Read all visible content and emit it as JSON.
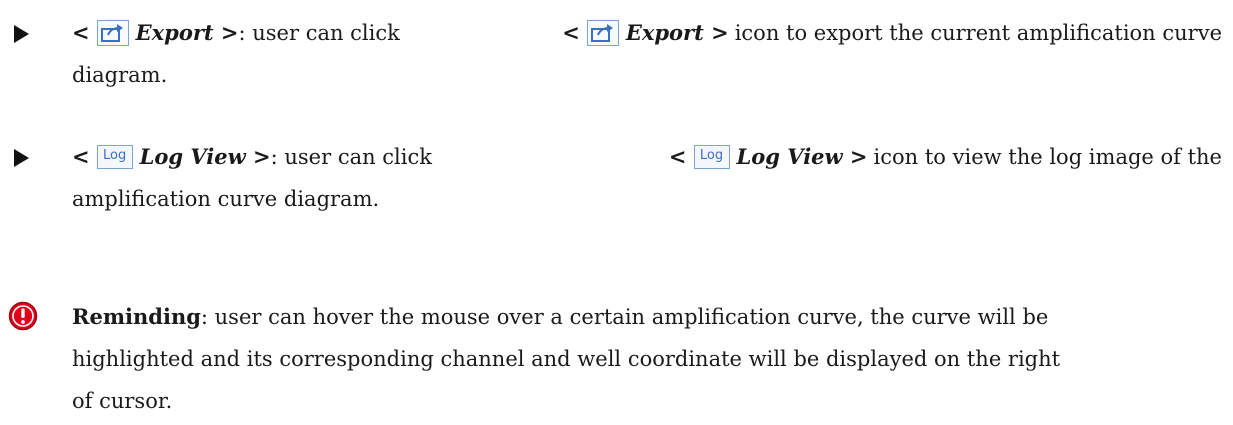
{
  "bullets": [
    {
      "open": "<",
      "title": "Export >",
      "lead": ": user can click",
      "open2": "<",
      "title2": "Export >",
      "rest": "icon to export the current amplification curve",
      "cont": "diagram.",
      "icon": "export-icon"
    },
    {
      "open": "<",
      "title": "Log View >",
      "lead": ": user can click",
      "open2": "<",
      "title2": "Log View >",
      "rest": "icon to view the log image of the",
      "cont": "amplification curve diagram.",
      "icon": "log-icon",
      "icon_text": "Log"
    }
  ],
  "reminder": {
    "icon": "exclamation-circle-icon",
    "label": "Reminding",
    "line1": ": user can hover the mouse over a certain amplification curve, the curve will be",
    "line2": "highlighted and its corresponding channel and well coordinate will be displayed on the right",
    "line3": "of cursor."
  },
  "colors": {
    "reminder_red": "#e0001b",
    "icon_blue": "#3b6fbf",
    "icon_border": "#7aa3d6"
  }
}
